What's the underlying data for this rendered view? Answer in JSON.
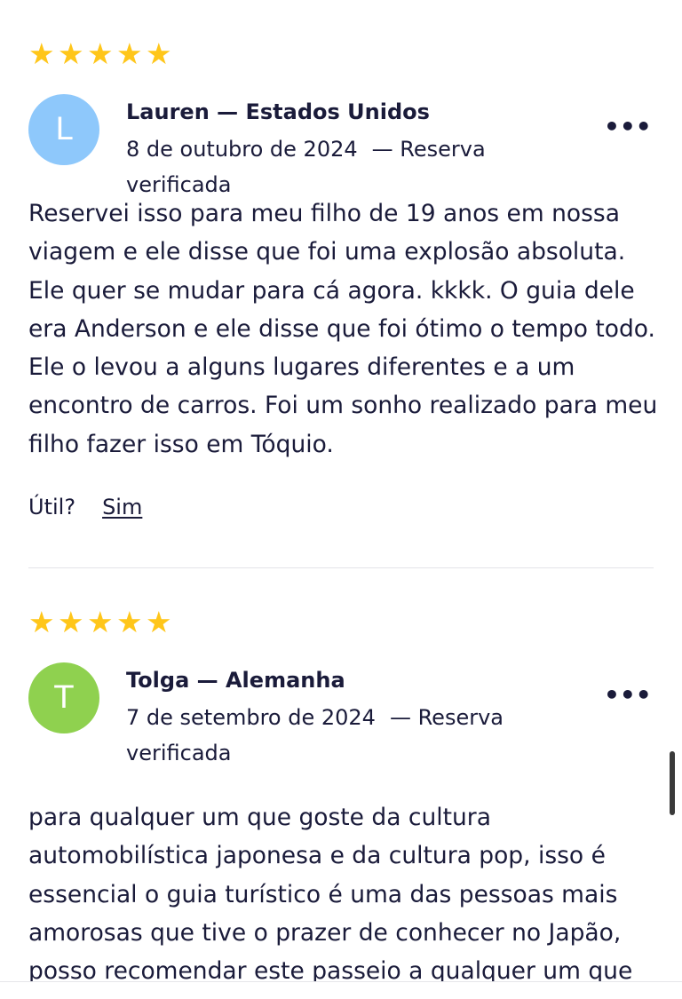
{
  "reviews": [
    {
      "rating": 5,
      "avatar_initial": "L",
      "avatar_color": "#8ec8fb",
      "name": "Lauren — Estados Unidos",
      "date": "8 de outubro de 2024",
      "verified": "— Reserva verificada",
      "text": "Reservei isso para meu filho de 19 anos em nossa viagem e ele disse que foi uma explosão absoluta. Ele quer se mudar para cá agora. kkkk. O guia dele era Anderson e ele disse que foi ótimo o tempo todo. Ele o levou a alguns lugares diferentes e a um encontro de carros. Foi um sonho realizado para meu filho fazer isso em Tóquio.",
      "helpful_label": "Útil?",
      "helpful_yes": "Sim"
    },
    {
      "rating": 5,
      "avatar_initial": "T",
      "avatar_color": "#8fd14f",
      "name": "Tolga — Alemanha",
      "date": "7 de setembro de 2024",
      "verified": "— Reserva verificada",
      "text": "para qualquer um que goste da cultura automobilística japonesa e da cultura pop, isso é essencial o guia turístico é uma das pessoas mais amorosas que tive o prazer de conhecer no Japão, posso recomendar este passeio a qualquer um que"
    }
  ],
  "icons": {
    "star": "★",
    "more": "•••"
  },
  "colors": {
    "star": "#ffc61a",
    "text": "#1a1b3a"
  }
}
